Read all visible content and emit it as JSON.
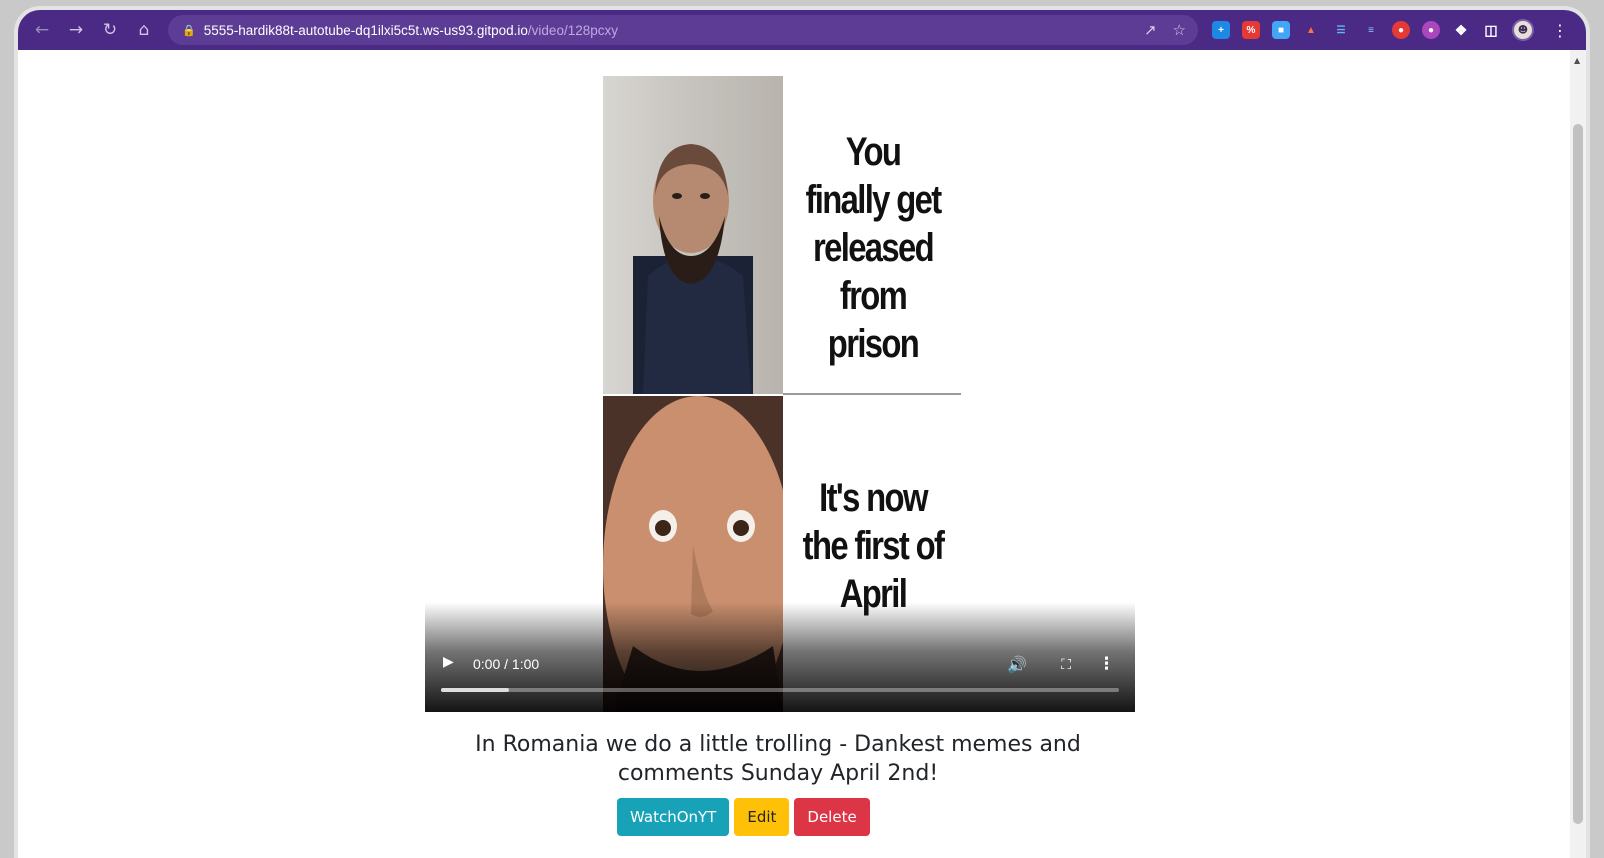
{
  "browser": {
    "url_host": "5555-hardik88t-autotube-dq1ilxi5c5t.ws-us93.gitpod.io",
    "url_path": "/video/128pcxy",
    "theme_color": "#4a2a84"
  },
  "video": {
    "caption_top": "You finally get released from prison",
    "caption_bottom": "It's now the first of April",
    "time_display": "0:00 / 1:00",
    "progress_buffered": 0.1
  },
  "page": {
    "title": "In Romania we do a little trolling - Dankest memes and comments Sunday April 2nd!",
    "buttons": {
      "watch": "WatchOnYT",
      "edit": "Edit",
      "delete": "Delete"
    }
  }
}
